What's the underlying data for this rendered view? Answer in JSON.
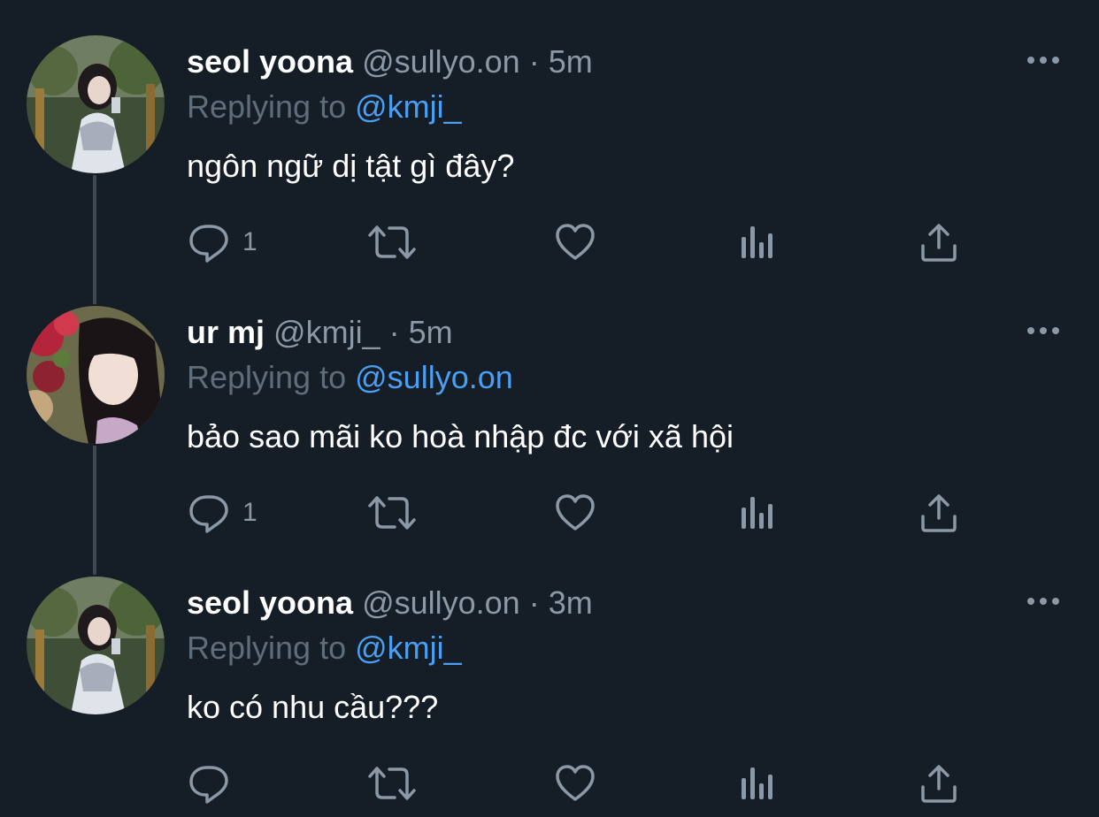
{
  "colors": {
    "background": "#151d27",
    "thread_line": "#3d4854",
    "name": "#ffffff",
    "muted": "#8b98a5",
    "replying_to": "#5f6d7a",
    "mention": "#4a9ff2",
    "icon": "#8b98a5"
  },
  "tweets": [
    {
      "name": "seol yoona",
      "handle": "@sullyo.on",
      "separator": "·",
      "time": "5m",
      "replying_label": "Replying to",
      "replying_to": "@kmji_",
      "text": "ngôn ngữ dị tật gì đây?",
      "reply_count": "1",
      "avatar_icon": "avatar-girl-white-dress"
    },
    {
      "name": "ur mj",
      "handle": "@kmji_",
      "separator": "·",
      "time": "5m",
      "replying_label": "Replying to",
      "replying_to": "@sullyo.on",
      "text": "bảo sao mãi ko hoà nhập đc với xã hội",
      "reply_count": "1",
      "avatar_icon": "avatar-girl-flowers"
    },
    {
      "name": "seol yoona",
      "handle": "@sullyo.on",
      "separator": "·",
      "time": "3m",
      "replying_label": "Replying to",
      "replying_to": "@kmji_",
      "text": "ko có nhu cầu???",
      "reply_count": "",
      "avatar_icon": "avatar-girl-white-dress"
    }
  ],
  "action_icons": [
    "reply-icon",
    "retweet-icon",
    "like-icon",
    "analytics-icon",
    "share-icon",
    "more-icon"
  ]
}
